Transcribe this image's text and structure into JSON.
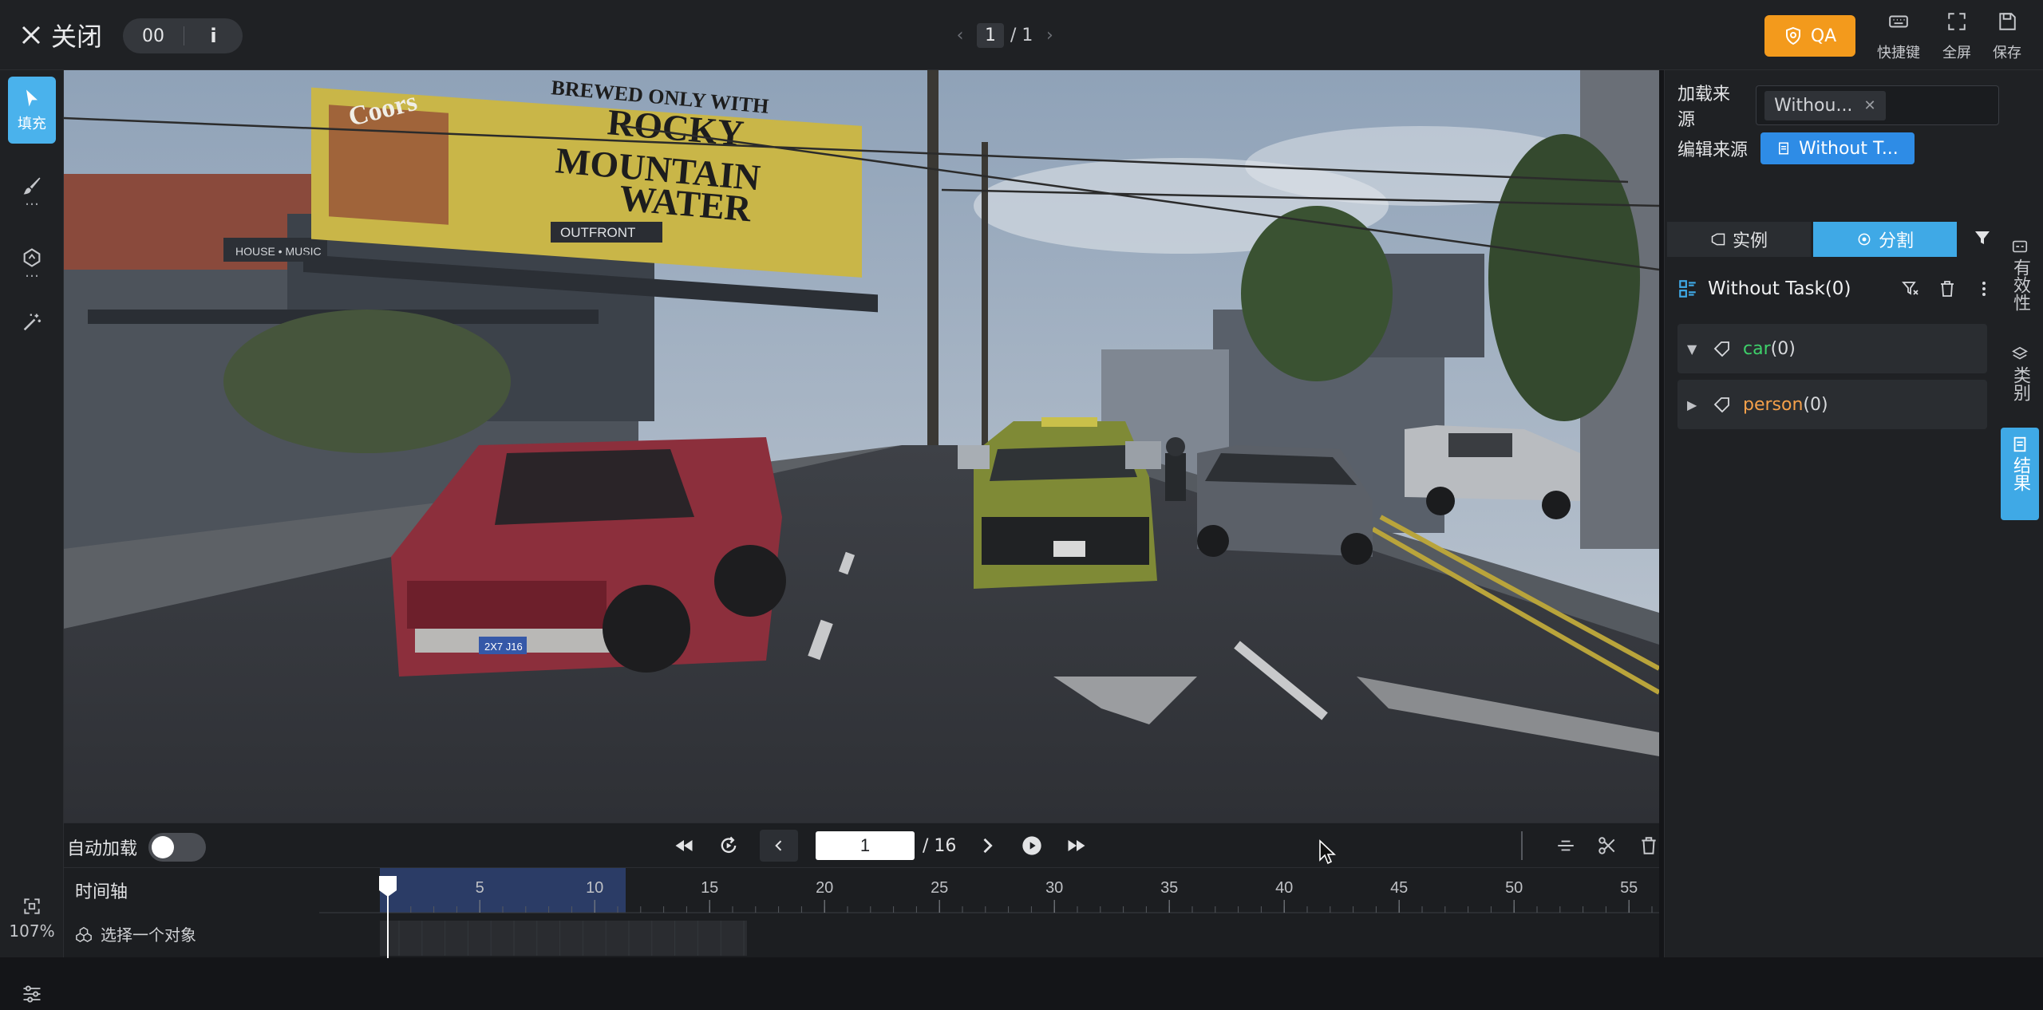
{
  "topbar": {
    "close_label": "关闭",
    "frame_badge": "00",
    "info_glyph": "i",
    "page_current": "1",
    "page_total": "/ 1",
    "qa_label": "QA",
    "shortcut_label": "快捷键",
    "fullscreen_label": "全屏",
    "save_label": "保存"
  },
  "left_toolbar": {
    "fill_label": "填充",
    "zoom_label": "107%",
    "icons": [
      "select-pointer-icon",
      "brush-icon",
      "polygon-icon",
      "magic-wand-icon",
      "fit-screen-icon",
      "settings-sliders-icon"
    ]
  },
  "canvas": {
    "scene": "street",
    "billboard_line1": "BREWED ONLY WITH",
    "billboard_line2": "ROCKY",
    "billboard_line3": "MOUNTAIN",
    "billboard_line4": "WATER",
    "brand_text": "Coors",
    "banner_text": "OUTFRONT",
    "house_music_text": "HOUSE • MUSIC",
    "plate_text": "2X7 J16"
  },
  "controls": {
    "autoload_label": "自动加载",
    "autoload_on": false,
    "frame_value": "1",
    "frame_total": "/ 16"
  },
  "timeline": {
    "label": "时间轴",
    "object_prompt": "选择一个对象",
    "ticks": [
      "5",
      "10",
      "15",
      "20",
      "25",
      "30",
      "35",
      "40",
      "45",
      "50",
      "55"
    ],
    "current_frame": 1,
    "loaded_range_end": 10
  },
  "right_panel": {
    "load_source_label": "加载来源",
    "load_source_tag": "Withou...",
    "edit_source_label": "编辑来源",
    "edit_source_tag": "Without T...",
    "tab_instance": "实例",
    "tab_segment": "分割",
    "task_title": "Without Task(0)",
    "classes": [
      {
        "name": "car",
        "count": "(0)",
        "color": "#3ed06a",
        "expanded": true
      },
      {
        "name": "person",
        "count": "(0)",
        "color": "#f5a04a",
        "expanded": false
      }
    ]
  },
  "right_sidebar": {
    "validity_label": "有效性",
    "category_label": "类别",
    "result_label": "结果"
  },
  "colors": {
    "accent_blue": "#3fa9e6",
    "qa_orange": "#f39a1c",
    "panel_bg": "#1f2124"
  }
}
